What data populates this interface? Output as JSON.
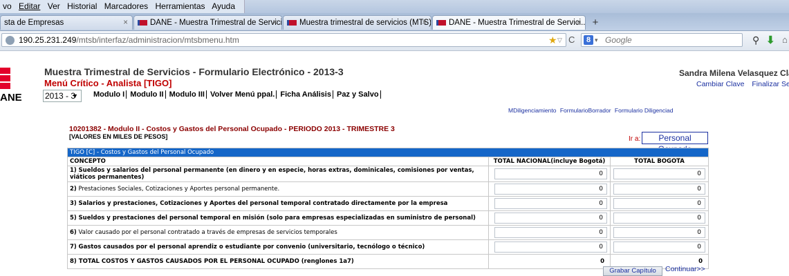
{
  "browser": {
    "menu": [
      "vo",
      "Editar",
      "Ver",
      "Historial",
      "Marcadores",
      "Herramientas",
      "Ayuda"
    ],
    "tabs": [
      {
        "label": "sta de Empresas"
      },
      {
        "label": "DANE - Muestra Trimestral de Servici..."
      },
      {
        "label": "Muestra trimestral de servicios (MTS)"
      },
      {
        "label": "DANE - Muestra Trimestral de Servici..."
      }
    ],
    "tab_close": "×",
    "new_tab": "+",
    "url_host": "190.25.231.249",
    "url_path": "/mtsb/interfaz/administracion/mtsbmenu.htm",
    "search_placeholder": "Google",
    "search_engine_letter": "8"
  },
  "header": {
    "logo_text": "ANE",
    "title": "Muestra Trimestral de Servicios - Formulario Electrónico - 2013-3",
    "subtitle": "Menú Crítico - Analista [TIGO]",
    "period": "2013 - 3",
    "nav": [
      "Modulo I",
      "Modulo II",
      "Modulo III",
      "Volver Menú ppal.",
      "Ficha Análisis",
      "Paz y Salvo"
    ],
    "user_name": "Sandra Milena Velasquez Clav",
    "user_links": [
      "Cambiar Clave",
      "Finalizar Ses"
    ],
    "doc_links": [
      "MDiligenciamiento",
      "FormularioBorrador",
      "Formulario Diligenciad"
    ]
  },
  "form": {
    "title": "10201382 - Modulo II - Costos y Gastos del Personal Ocupado - PERIODO 2013 - TRIMESTRE 3",
    "units": "[VALORES EN MILES DE PESOS]",
    "ir_a_label": "Ir a:",
    "ir_a_value": "Personal Ocupado",
    "caption": "TIGO [C] - Costos y Gastos del Personal Ocupado",
    "col_concepto": "CONCEPTO",
    "col_nacional": "TOTAL NACIONAL(incluye Bogotá)",
    "col_bogota": "TOTAL BOGOTA",
    "rows": [
      {
        "num": "1)",
        "text": "Sueldos y salarios del personal permanente (en dinero y en especie, horas extras, dominicales, comisiones por ventas, viáticos permanentes)",
        "bold": true,
        "nacional": "0",
        "bogota": "0"
      },
      {
        "num": "2)",
        "text": "Prestaciones Sociales, Cotizaciones y Aportes personal permanente.",
        "bold": false,
        "nacional": "0",
        "bogota": "0"
      },
      {
        "num": "3)",
        "text": "Salarios y prestaciones, Cotizaciones y Aportes del personal temporal contratado directamente por la empresa",
        "bold": true,
        "nacional": "0",
        "bogota": "0"
      },
      {
        "num": "5)",
        "text": "Sueldos y prestaciones del personal temporal en misión (solo para empresas especializadas en suministro de personal)",
        "bold": true,
        "nacional": "0",
        "bogota": "0"
      },
      {
        "num": "6)",
        "text": "Valor causado por el personal contratado a través de empresas de servicios temporales",
        "bold": false,
        "nacional": "0",
        "bogota": "0"
      },
      {
        "num": "7)",
        "text": "Gastos causados por el personal aprendiz o estudiante por convenio (universitario, tecnólogo o técnico)",
        "bold": true,
        "nacional": "0",
        "bogota": "0"
      }
    ],
    "total_row": {
      "num": "8)",
      "text": "TOTAL COSTOS Y GASTOS CAUSADOS POR EL PERSONAL OCUPADO (renglones 1a7)",
      "nacional": "0",
      "bogota": "0"
    },
    "save_label": "Grabar Capítulo",
    "continue_label": "Continuar>>"
  },
  "colors": {
    "accent": "#1566c8",
    "brand_red": "#e3002b",
    "title_red": "#c00000"
  }
}
